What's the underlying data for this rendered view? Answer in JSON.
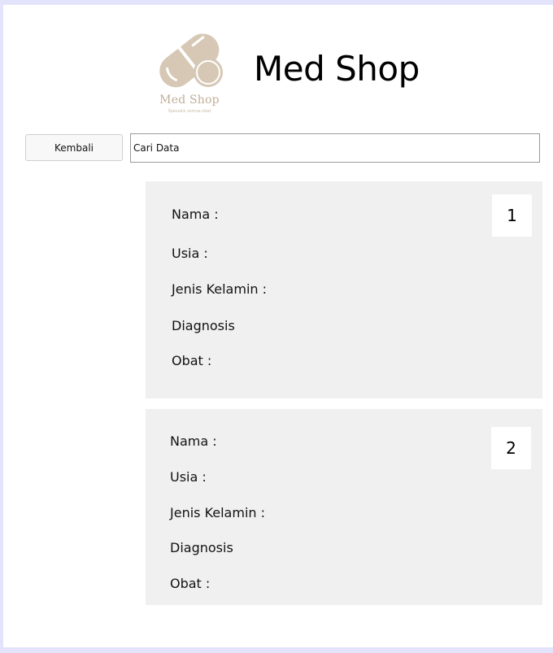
{
  "header": {
    "title": "Med Shop",
    "logo": {
      "name": "Med Shop",
      "tagline": "Spesialis semua obat",
      "icon": "pill-capsule-icon",
      "color": "#d6c8b4"
    }
  },
  "toolbar": {
    "back_label": "Kembali",
    "search_value": "Cari Data",
    "search_placeholder": "Cari Data"
  },
  "records": [
    {
      "number": "1",
      "nama_label": "Nama :",
      "usia_label": "Usia :",
      "jenis_kelamin_label": "Jenis Kelamin :",
      "diagnosis_label": "Diagnosis",
      "obat_label": "Obat :"
    },
    {
      "number": "2",
      "nama_label": "Nama :",
      "usia_label": "Usia :",
      "jenis_kelamin_label": "Jenis Kelamin :",
      "diagnosis_label": "Diagnosis",
      "obat_label": "Obat :"
    }
  ],
  "colors": {
    "window_border": "#e3e4fb",
    "card_bg": "#f0f0f0",
    "logo_tan": "#d6c8b4"
  }
}
